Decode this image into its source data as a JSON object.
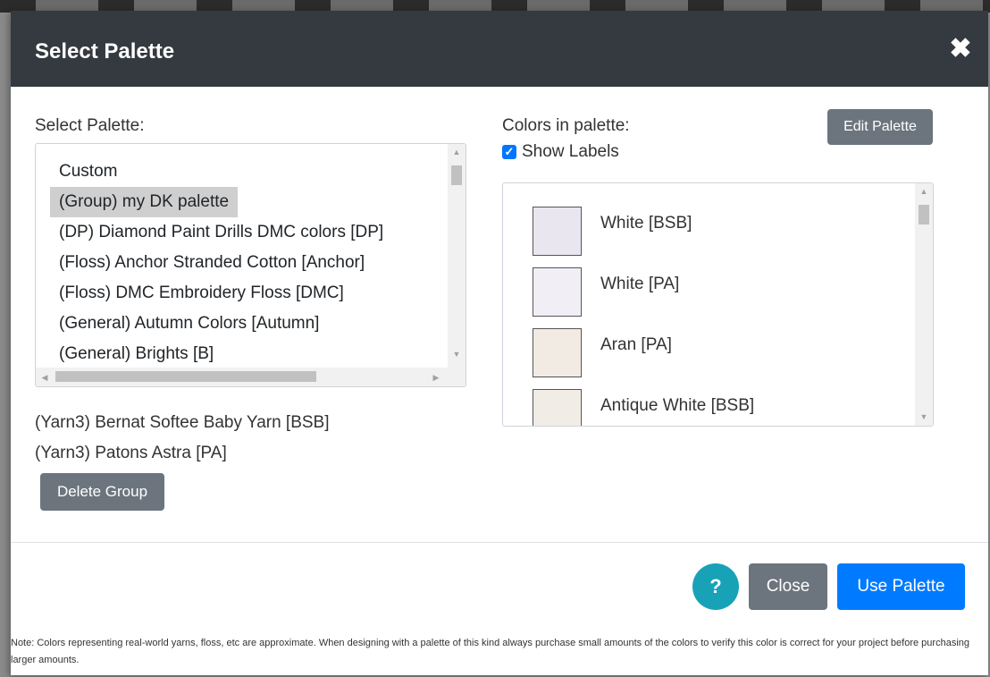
{
  "dialog": {
    "title": "Select Palette",
    "close_glyph": "✖"
  },
  "palette_list": {
    "label": "Select Palette:",
    "options": [
      "Custom",
      "(Group) my DK palette",
      "(DP) Diamond Paint Drills DMC colors [DP]",
      "(Floss) Anchor Stranded Cotton [Anchor]",
      "(Floss) DMC Embroidery Floss [DMC]",
      "(General) Autumn Colors [Autumn]",
      "(General) Brights [B]"
    ],
    "selected_index": 1
  },
  "group_members": [
    "(Yarn3) Bernat Softee Baby Yarn [BSB]",
    "(Yarn3) Patons Astra [PA]"
  ],
  "delete_group_label": "Delete Group",
  "colors_panel": {
    "label": "Colors in palette:",
    "show_labels_text": "Show Labels",
    "show_labels_checked": true,
    "edit_palette_label": "Edit Palette",
    "swatches": [
      {
        "name": "White [BSB]",
        "color": "#e9e6ef"
      },
      {
        "name": "White [PA]",
        "color": "#f1eff5"
      },
      {
        "name": "Aran [PA]",
        "color": "#f1ebe3"
      },
      {
        "name": "Antique White [BSB]",
        "color": "#f2ece6"
      }
    ]
  },
  "footer": {
    "help_glyph": "?",
    "close_label": "Close",
    "use_palette_label": "Use Palette",
    "note": "Note: Colors representing real-world yarns, floss, etc are approximate. When designing with a palette of this kind always purchase small amounts of the colors to verify this color is correct for your project before purchasing larger amounts."
  },
  "colors": {
    "header_bg": "#343a40",
    "primary": "#007bff",
    "secondary": "#6c757d",
    "info": "#17a2b8"
  }
}
